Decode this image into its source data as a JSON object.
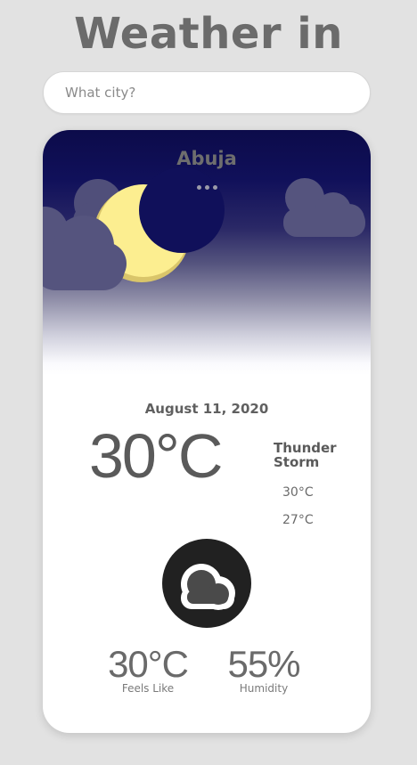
{
  "header": {
    "title": "Weather in"
  },
  "search": {
    "placeholder": "What city?",
    "value": ""
  },
  "weather": {
    "city": "Abuja",
    "date": "August 11, 2020",
    "temperature": "30°C",
    "condition": "Thunder Storm",
    "high": "30°C",
    "low": "27°C",
    "icon": "cloud-icon",
    "feels_like": {
      "value": "30°C",
      "label": "Feels Like"
    },
    "humidity": {
      "value": "55%",
      "label": "Humidity"
    }
  },
  "colors": {
    "background": "#e2e2e2",
    "sky_top": "#0c0b4a",
    "moon": "#fcee90",
    "cloud": "#55547e",
    "icon_circle": "#212121",
    "text": "#6b6b6b"
  }
}
